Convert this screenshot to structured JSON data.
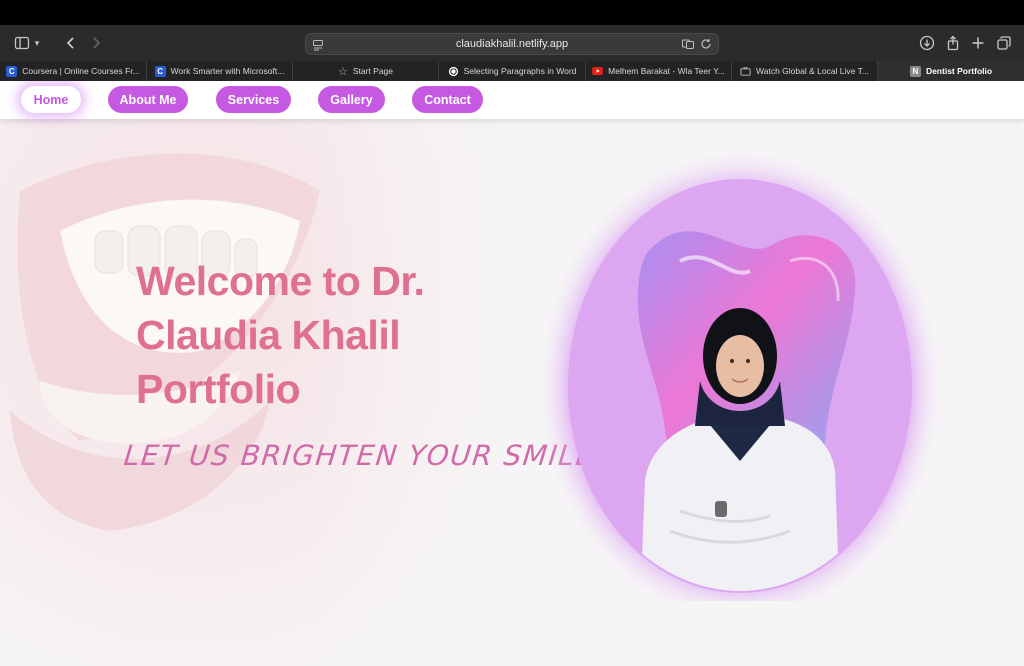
{
  "browser": {
    "url": "claudiakhalil.netlify.app",
    "tabs": [
      {
        "label": "Coursera | Online Courses Fr...",
        "favicon": "C",
        "color": "#2a5bd7"
      },
      {
        "label": "Work Smarter with Microsoft...",
        "favicon": "C",
        "color": "#2a5bd7"
      },
      {
        "label": "Start Page",
        "favicon": "star-icon",
        "color": "#888888"
      },
      {
        "label": "Selecting Paragraphs in Word",
        "favicon": "openai-icon",
        "color": "#444444"
      },
      {
        "label": "Melhem Barakat - Wla Teer Y...",
        "favicon": "youtube-icon",
        "color": "#e62117"
      },
      {
        "label": "Watch Global & Local Live T...",
        "favicon": "tv-icon",
        "color": "#777777"
      },
      {
        "label": "Dentist Portfolio",
        "favicon": "N",
        "color": "#8a8a8a",
        "active": true
      }
    ]
  },
  "nav": {
    "items": [
      "Home",
      "About Me",
      "Services",
      "Gallery",
      "Contact"
    ],
    "active": "Home",
    "accent": "#c659e2"
  },
  "hero": {
    "title": "Welcome to Dr. Claudia Khalil Portfolio",
    "tagline": "LET US BRIGHTEN YOUR SMILE",
    "title_color": "#df7090"
  }
}
